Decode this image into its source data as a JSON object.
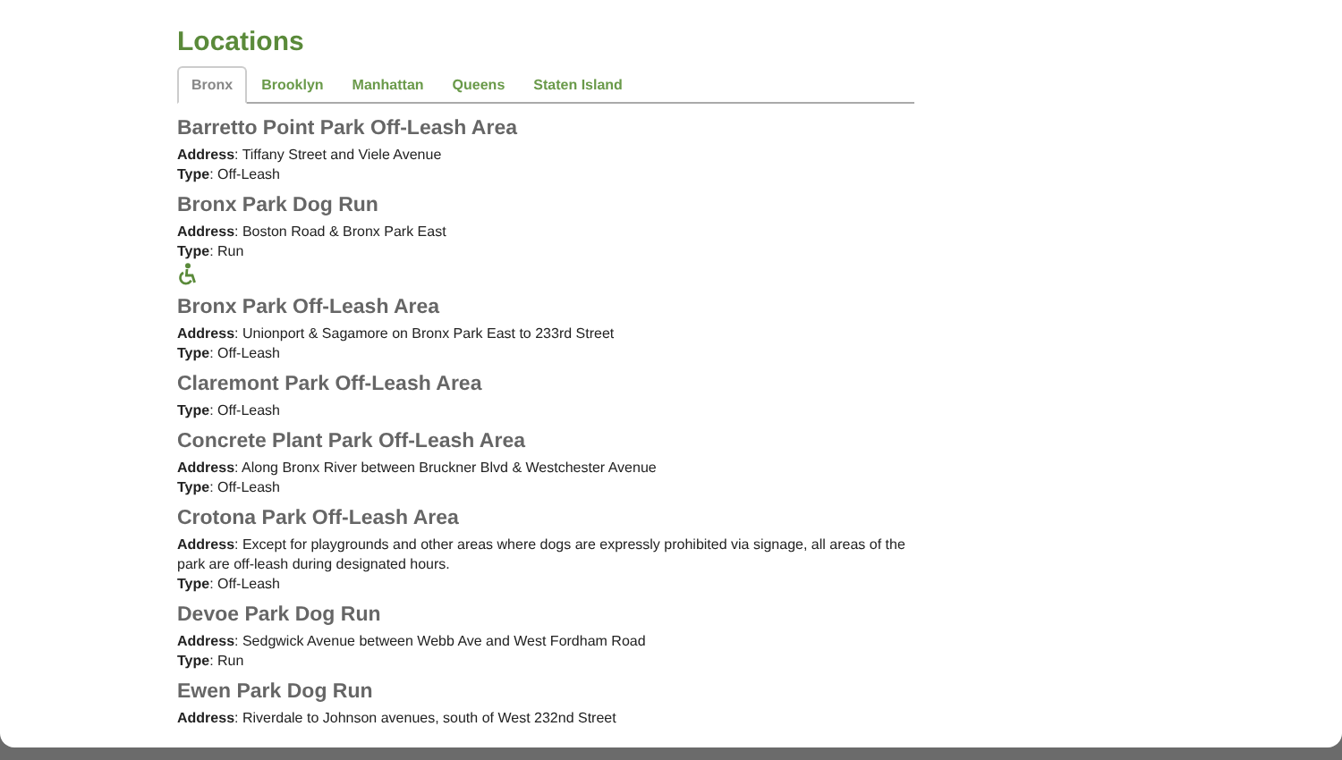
{
  "title": "Locations",
  "tabs": [
    {
      "label": "Bronx",
      "selected": true
    },
    {
      "label": "Brooklyn",
      "selected": false
    },
    {
      "label": "Manhattan",
      "selected": false
    },
    {
      "label": "Queens",
      "selected": false
    },
    {
      "label": "Staten Island",
      "selected": false
    }
  ],
  "locations": [
    {
      "name": "Barretto Point Park Off-Leash Area",
      "address": "**Address**: Tiffany Street and Viele Avenue",
      "type": "**Type**: Off-Leash",
      "accessible": false
    },
    {
      "name": "Bronx Park Dog Run",
      "address": "**Address**: Boston Road & Bronx Park East",
      "type": "**Type**: Run",
      "accessible": true
    },
    {
      "name": "Bronx Park Off-Leash Area",
      "address": "**Address**: Unionport & Sagamore on Bronx Park East to 233rd Street",
      "type": "**Type**: Off-Leash",
      "accessible": false
    },
    {
      "name": "Claremont Park Off-Leash Area",
      "type": "**Type**: Off-Leash",
      "accessible": false
    },
    {
      "name": "Concrete Plant Park Off-Leash Area",
      "address": "**Address**: Along Bronx River between Bruckner Blvd & Westchester Avenue",
      "type": "**Type**: Off-Leash",
      "accessible": false
    },
    {
      "name": "Crotona Park Off-Leash Area",
      "address": "**Address**: Except for playgrounds and other areas where dogs are expressly prohibited via signage, all areas of the park are off-leash during designated hours.",
      "type": "**Type**: Off-Leash",
      "accessible": false
    },
    {
      "name": "Devoe Park Dog Run",
      "address": "**Address**: Sedgwick Avenue between Webb Ave and West Fordham Road",
      "type": "**Type**: Run",
      "accessible": false
    },
    {
      "name": "Ewen Park Dog Run",
      "address": "**Address**: Riverdale to Johnson avenues, south of West 232nd Street",
      "accessible": false
    }
  ]
}
